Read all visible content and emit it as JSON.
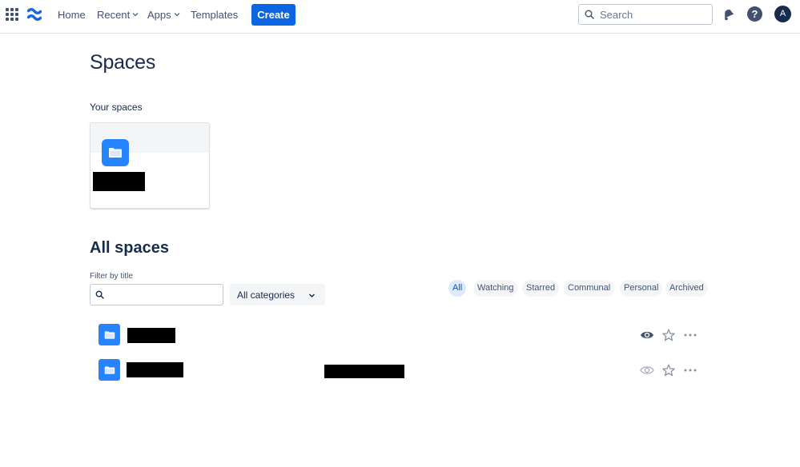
{
  "topbar": {
    "nav": {
      "home": "Home",
      "recent": "Recent",
      "apps": "Apps",
      "templates": "Templates"
    },
    "create_label": "Create",
    "search_placeholder": "Search",
    "help_label": "?",
    "avatar_initial": "A"
  },
  "page": {
    "title": "Spaces",
    "your_spaces_label": "Your spaces",
    "all_spaces_title": "All spaces",
    "filter_label": "Filter by title",
    "filter_value": "",
    "category_selected": "All categories",
    "tabs": [
      "All",
      "Watching",
      "Starred",
      "Communal",
      "Personal",
      "Archived"
    ],
    "active_tab": "All"
  },
  "spaces": [
    {
      "watching": true,
      "starred": false
    },
    {
      "watching": false,
      "starred": false
    }
  ],
  "colors": {
    "primary": "#0c66e4",
    "space_icon": "#2684ff",
    "text": "#172b4d",
    "active_tab_bg": "#deebff"
  },
  "icons": {
    "app_switcher": "grid-icon",
    "logo": "confluence-logo",
    "search": "search-icon",
    "notifications": "bell-icon",
    "help": "help-icon",
    "space": "folder-icon",
    "watch": "eye-icon",
    "star": "star-icon",
    "more": "more-icon"
  }
}
